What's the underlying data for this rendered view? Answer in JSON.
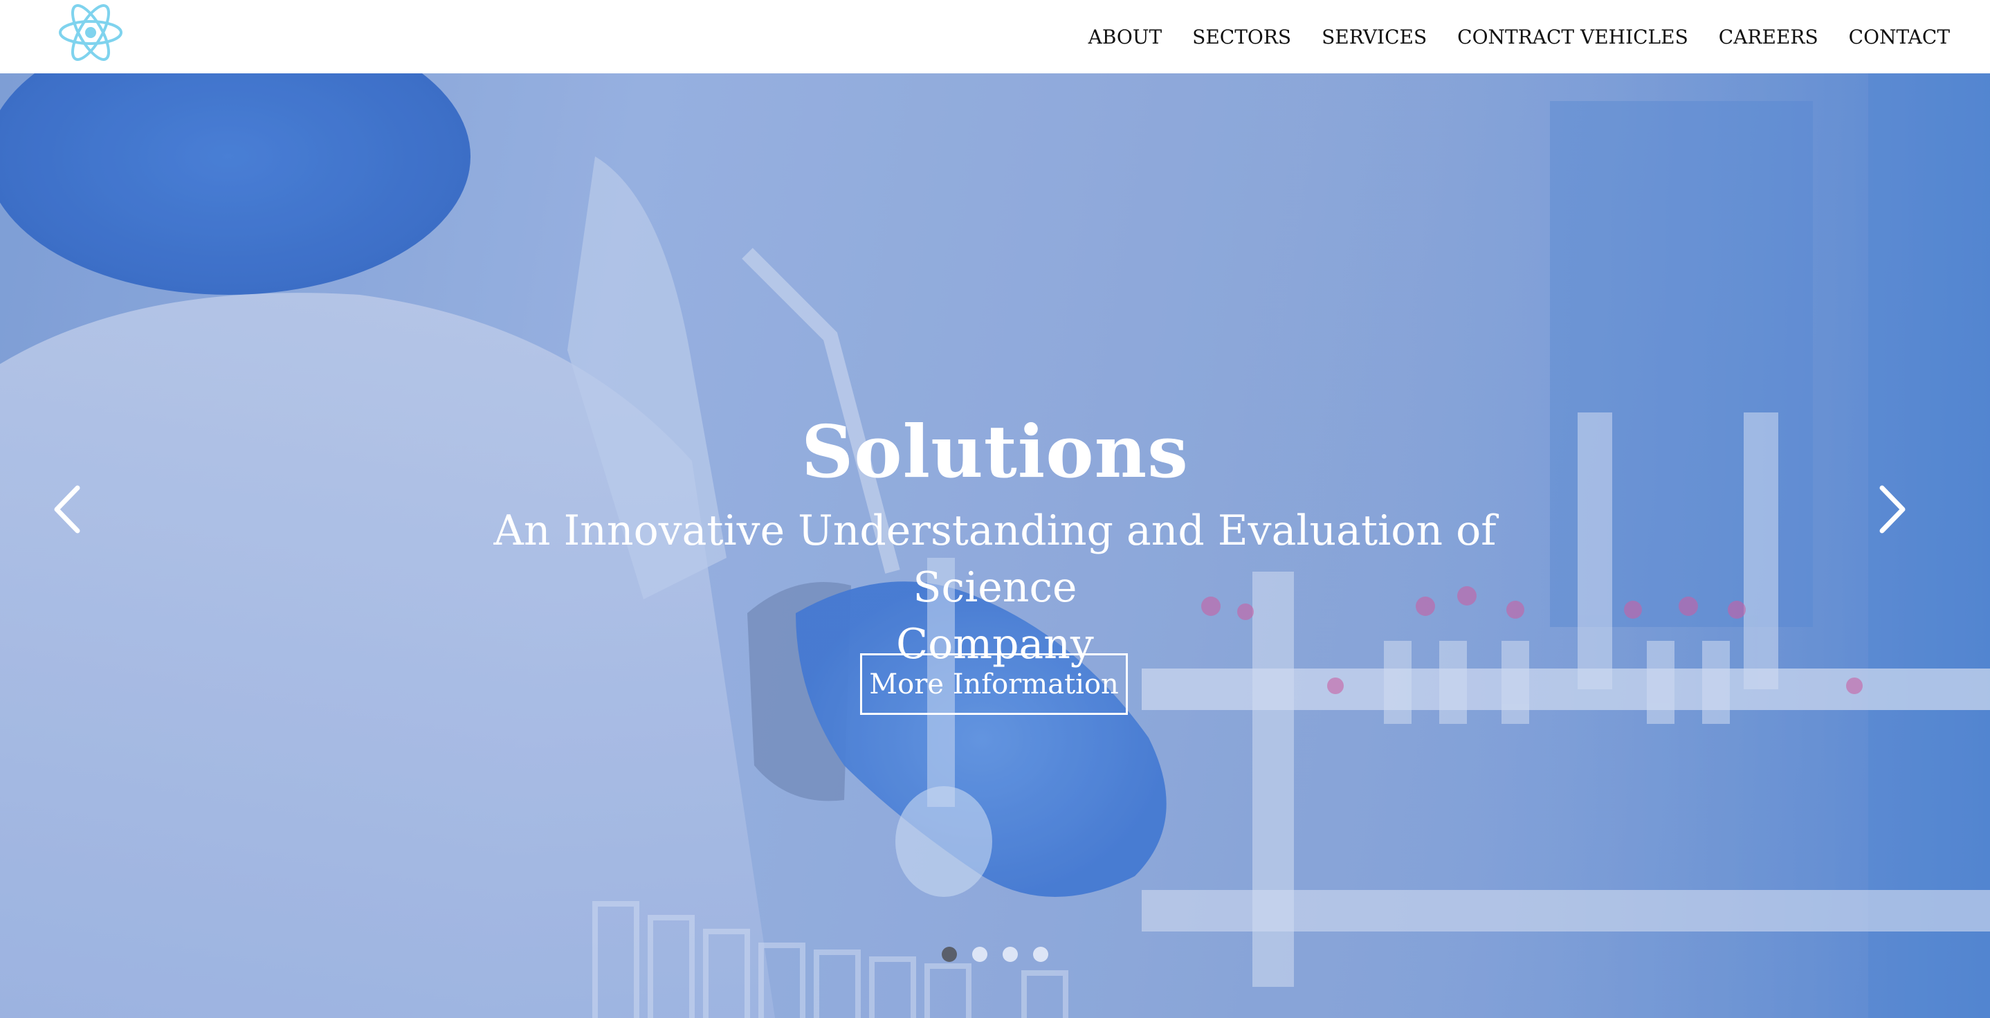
{
  "header": {
    "logo_icon": "atom-icon",
    "nav": [
      {
        "label": "ABOUT"
      },
      {
        "label": "SECTORS"
      },
      {
        "label": "SERVICES"
      },
      {
        "label": "CONTRACT VEHICLES"
      },
      {
        "label": "CAREERS"
      },
      {
        "label": "CONTACT"
      }
    ]
  },
  "hero": {
    "title": "Solutions",
    "subtitle_line1": "An Innovative Understanding and Evaluation of Science",
    "subtitle_line2": "Company",
    "button_label": "More Information",
    "prev_icon": "chevron-left-icon",
    "next_icon": "chevron-right-icon",
    "slide_count": 4,
    "active_slide": 1
  },
  "colors": {
    "logo": "#7fd3ee",
    "hero_tint": "#7fa0d6",
    "active_dot": "#5a5f6b",
    "inactive_dot": "#ebf0fa"
  }
}
